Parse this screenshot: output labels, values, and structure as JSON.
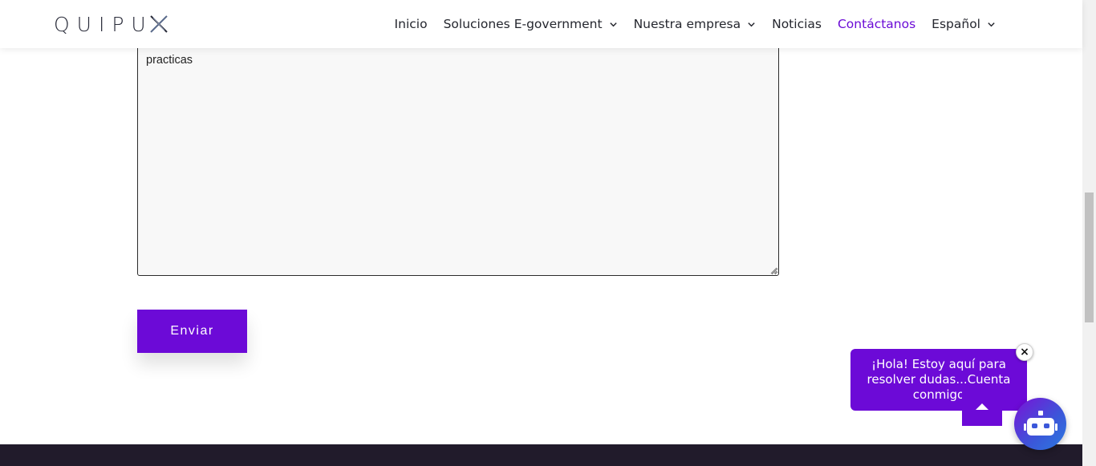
{
  "header": {
    "logo_text": "QUIPU",
    "nav": [
      {
        "label": "Inicio",
        "has_dropdown": false,
        "active": false
      },
      {
        "label": "Soluciones E-government",
        "has_dropdown": true,
        "active": false
      },
      {
        "label": "Nuestra empresa",
        "has_dropdown": true,
        "active": false
      },
      {
        "label": "Noticias",
        "has_dropdown": false,
        "active": false
      },
      {
        "label": "Contáctanos",
        "has_dropdown": false,
        "active": true
      },
      {
        "label": "Español",
        "has_dropdown": true,
        "active": false
      }
    ]
  },
  "form": {
    "message_value": "practicas",
    "submit_label": "Enviar"
  },
  "chat": {
    "greeting": "¡Hola! Estoy aquí para resolver dudas...Cuenta conmigo",
    "close_label": "×"
  },
  "colors": {
    "accent": "#6c0ad7",
    "nav_active": "#6b0bd6",
    "footer": "#211b2b"
  }
}
